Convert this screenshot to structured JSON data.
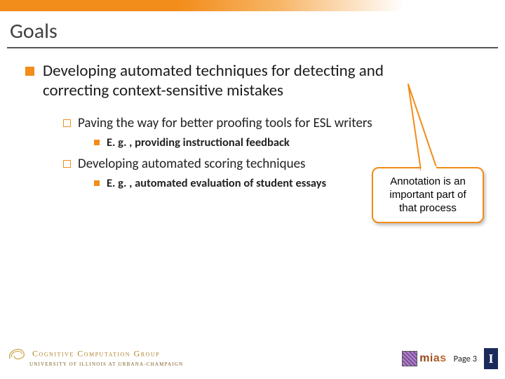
{
  "header": {
    "title": "Goals"
  },
  "bullets": {
    "lvl1": "Developing automated techniques for detecting and correcting context-sensitive mistakes",
    "lvl2a": "Paving the way for better proofing tools for ESL writers",
    "lvl3a": "E. g. , providing instructional feedback",
    "lvl2b": "Developing automated scoring techniques",
    "lvl3b": "E. g. , automated evaluation of student essays"
  },
  "callout": {
    "text": "Annotation is an important part of that process"
  },
  "footer": {
    "org_line1": "Cognitive Computation Group",
    "org_line2": "UNIVERSITY OF ILLINOIS AT URBANA-CHAMPAIGN",
    "mias": "mias",
    "page_label": "Page 3",
    "illinois_initial": "I"
  },
  "colors": {
    "accent": "#f28c1a"
  }
}
